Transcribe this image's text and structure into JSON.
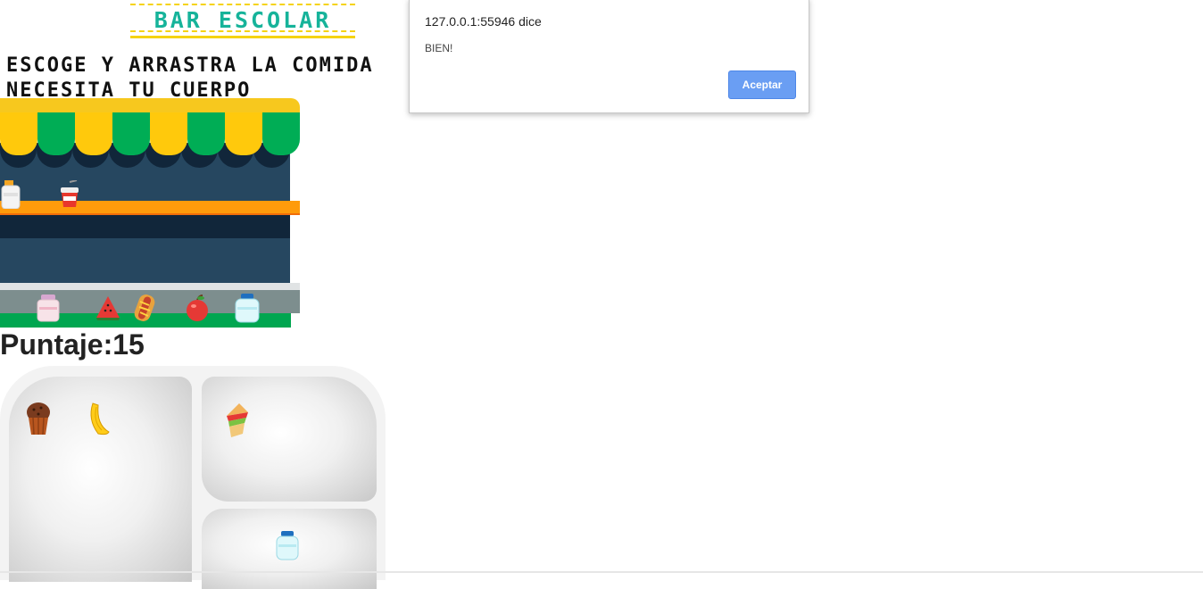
{
  "header": {
    "title": "BAR ESCOLAR"
  },
  "instructions": {
    "line1": "ESCOGE Y ARRASTRA LA COMIDA",
    "line2": "NECESITA TU CUERPO"
  },
  "score": {
    "label": "Puntaje:",
    "value": "15"
  },
  "store": {
    "shelf_items": [
      "milk-bottle-icon",
      "juice-cup-icon"
    ],
    "counter_items": [
      "pink-yogurt-jar-icon",
      "watermelon-icon",
      "hotdog-icon",
      "apple-icon",
      "water-bottle-icon"
    ]
  },
  "tray": {
    "left_items": [
      "muffin-icon",
      "banana-icon"
    ],
    "top_right_items": [
      "sandwich-icon"
    ],
    "bottom_right_items": [
      "water-bottle-icon"
    ]
  },
  "dialog": {
    "origin": "127.0.0.1:55946 dice",
    "message": "BIEN!",
    "ok_label": "Aceptar"
  },
  "colors": {
    "title": "#16b39a",
    "banner": "#f5d312",
    "awning_yellow": "#ffc90c",
    "awning_green": "#00ad55",
    "button": "#6a9ef3"
  }
}
